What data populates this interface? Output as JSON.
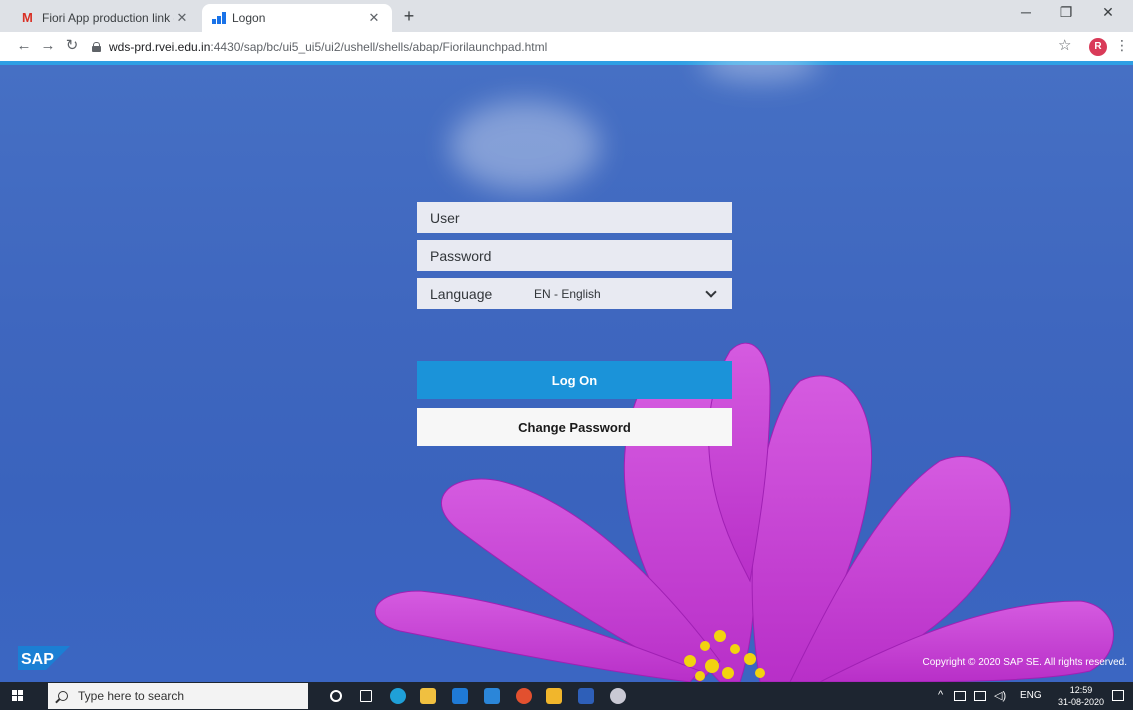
{
  "browser": {
    "tabs": [
      {
        "title": "Fiori App production link - ranga"
      },
      {
        "title": "Logon"
      }
    ],
    "new_tab": "+",
    "url_host": "wds-prd.rvei.edu.in",
    "url_path": ":4430/sap/bc/ui5_ui5/ui2/ushell/shells/abap/Fiorilaunchpad.html",
    "profile_initial": "R"
  },
  "logon": {
    "user_placeholder": "User",
    "password_placeholder": "Password",
    "language_label": "Language",
    "language_value": "EN - English",
    "logon_label": "Log On",
    "change_password_label": "Change Password"
  },
  "footer": {
    "logo_text": "SAP",
    "copyright": "Copyright © 2020 SAP SE. All rights reserved."
  },
  "taskbar": {
    "search_placeholder": "Type here to search",
    "language": "ENG",
    "time": "12:59",
    "date": "31-08-2020"
  },
  "colors": {
    "accent": "#1b93d9",
    "background": "#3f67bf",
    "flower": "#c43fd1"
  }
}
